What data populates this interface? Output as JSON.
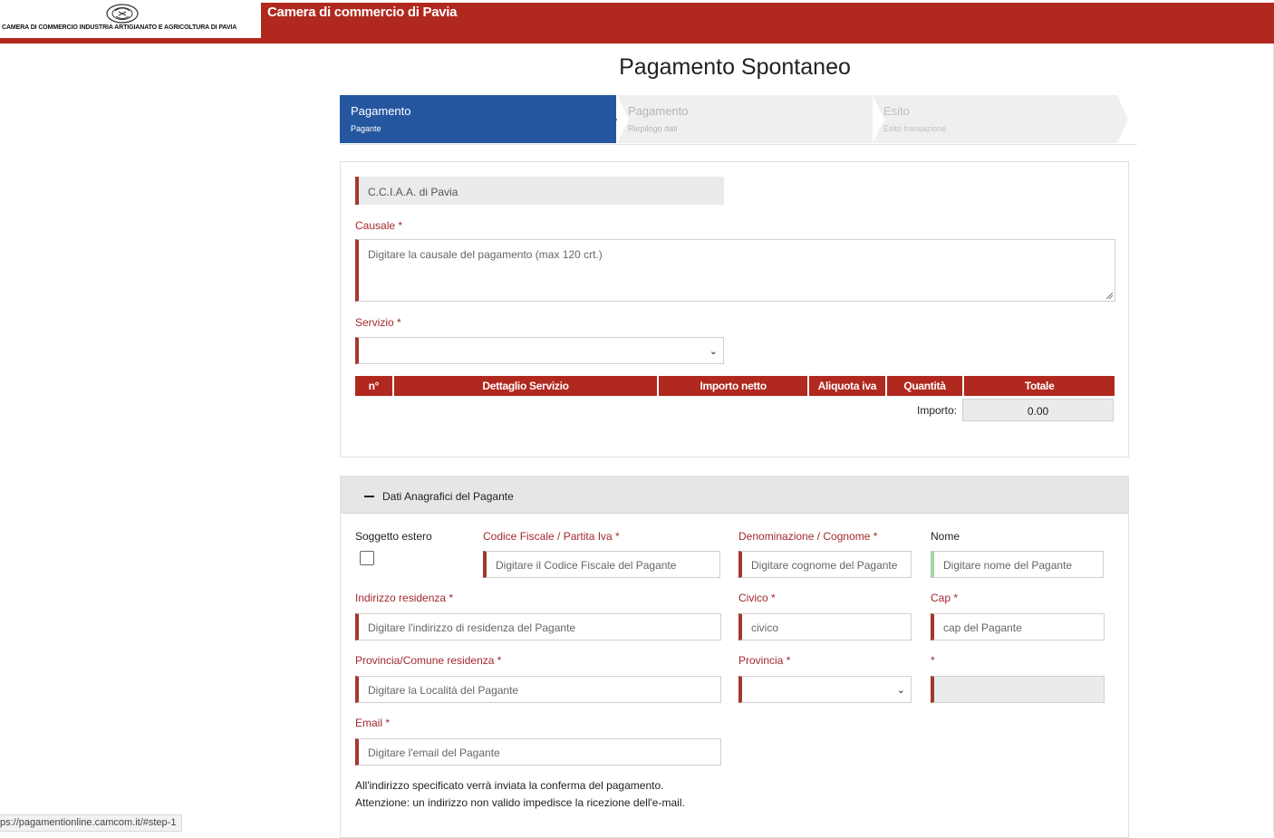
{
  "header": {
    "logo_text": "CAMERA DI COMMERCIO INDUSTRIA ARTIGIANATO E AGRICOLTURA DI PAVIA",
    "brand": "Camera di commercio di Pavia",
    "colors": {
      "brand_red": "#b0281e",
      "step_active": "#2457a0"
    }
  },
  "page_title": "Pagamento Spontaneo",
  "steps": [
    {
      "title": "Pagamento",
      "subtitle": "Pagante",
      "active": true
    },
    {
      "title": "Pagamento",
      "subtitle": "Riepilogo dati",
      "active": false
    },
    {
      "title": "Esito",
      "subtitle": "Esito transazione",
      "active": false
    }
  ],
  "payment": {
    "ente_value": "C.C.I.A.A. di Pavia",
    "causale_label": "Causale *",
    "causale_placeholder": "Digitare la causale del pagamento (max 120 crt.)",
    "servizio_label": "Servizio *",
    "servizio_value": "",
    "table_headers": [
      "n°",
      "Dettaglio Servizio",
      "Importo netto",
      "Aliquota iva",
      "Quantità",
      "Totale"
    ],
    "importo_label": "Importo:",
    "importo_value": "0.00"
  },
  "payer": {
    "section_title": "Dati Anagrafici del Pagante",
    "soggetto_estero_label": "Soggetto estero",
    "soggetto_estero_checked": false,
    "cf_label": "Codice Fiscale / Partita Iva *",
    "cf_placeholder": "Digitare il Codice Fiscale del Pagante",
    "cognome_label": "Denominazione / Cognome *",
    "cognome_placeholder": "Digitare cognome del Pagante",
    "nome_label": "Nome",
    "nome_placeholder": "Digitare nome del Pagante",
    "indirizzo_label": "Indirizzo residenza *",
    "indirizzo_placeholder": "Digitare l'indirizzo di residenza del Pagante",
    "civico_label": "Civico *",
    "civico_placeholder": "civico",
    "cap_label": "Cap *",
    "cap_placeholder": "cap del Pagante",
    "comune_label": "Provincia/Comune residenza *",
    "comune_placeholder": "Digitare la Località del Pagante",
    "provincia_label": "Provincia *",
    "provincia_value": "",
    "extra_label": "*",
    "email_label": "Email *",
    "email_placeholder": "Digitare l'email del Pagante",
    "note_line1": "All'indirizzo specificato verrà inviata la conferma del pagamento.",
    "note_line2": "Attenzione: un indirizzo non valido impedisce la ricezione dell'e-mail."
  },
  "status_bar": {
    "url": "ps://pagamentionline.camcom.it/#step-1"
  }
}
